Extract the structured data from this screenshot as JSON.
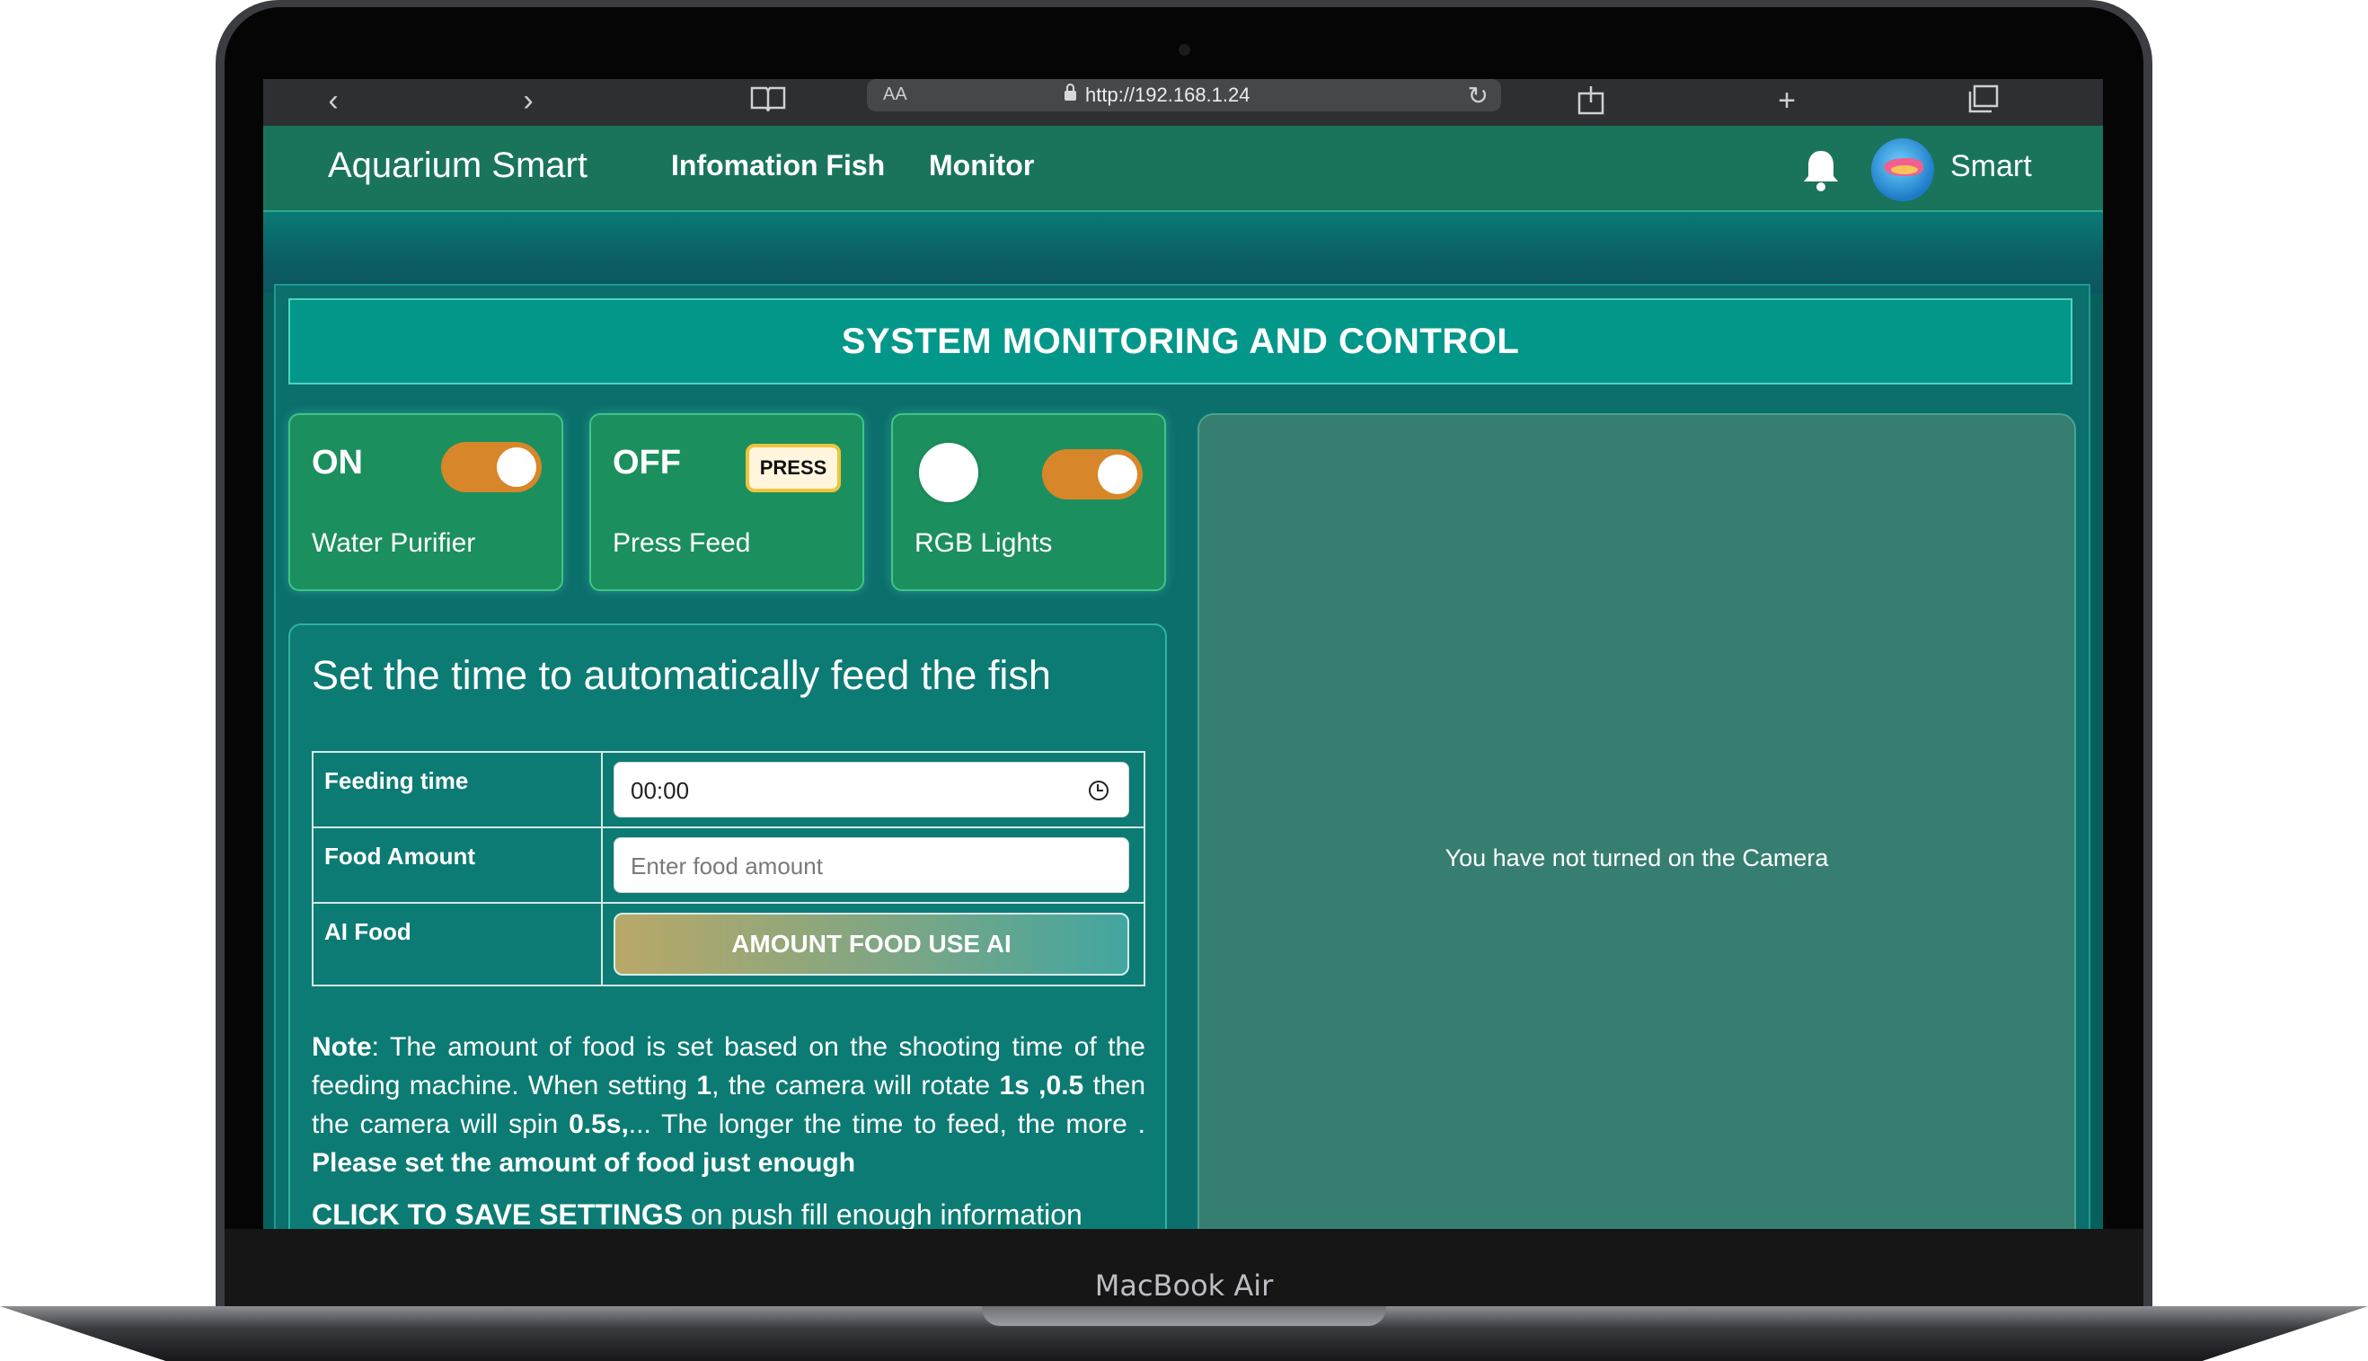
{
  "device": {
    "label": "MacBook Air"
  },
  "browser": {
    "text_size_label": "AA",
    "url": "http://192.168.1.24",
    "icons": [
      "back-icon",
      "forward-icon",
      "bookmarks-icon",
      "reload-icon",
      "share-icon",
      "new-tab-icon",
      "tabs-icon"
    ]
  },
  "navbar": {
    "brand": "Aquarium Smart",
    "links": [
      "Infomation Fish",
      "Monitor"
    ],
    "username": "Smart"
  },
  "page": {
    "title": "SYSTEM MONITORING AND CONTROL",
    "controls": [
      {
        "state": "ON",
        "label": "Water Purifier",
        "toggle_on": true
      },
      {
        "state": "OFF",
        "label": "Press Feed",
        "button": "PRESS"
      },
      {
        "label": "RGB Lights",
        "toggle_on": true
      }
    ],
    "feed": {
      "title": "Set the time to automatically feed the fish",
      "rows": {
        "time_label": "Feeding time",
        "time_value": "00:00",
        "amount_label": "Food Amount",
        "amount_placeholder": "Enter food amount",
        "ai_label": "AI Food",
        "ai_button": "AMOUNT FOOD USE AI"
      },
      "note": {
        "label": "Note",
        "t1": ": The amount of food is set based on the shooting time of the feeding machine. When setting ",
        "b1": "1",
        "t2": ", the camera will rotate ",
        "b2": "1s ,0.5",
        "t3": " then the camera will spin ",
        "b3": "0.5s,",
        "t4": "... The longer the time to feed, the more . ",
        "b4": "Please set the amount of food just enough"
      },
      "save": {
        "bold": "CLICK TO SAVE SETTINGS",
        "rest": " on push fill enough information"
      }
    },
    "camera": {
      "message": "You have not turned on the Camera"
    }
  },
  "colors": {
    "navbar": "#1a745c",
    "title_bar": "#03978a",
    "card": "#1c8f5e",
    "toggle_on": "#d8862a",
    "camera_panel": "#367f70"
  }
}
